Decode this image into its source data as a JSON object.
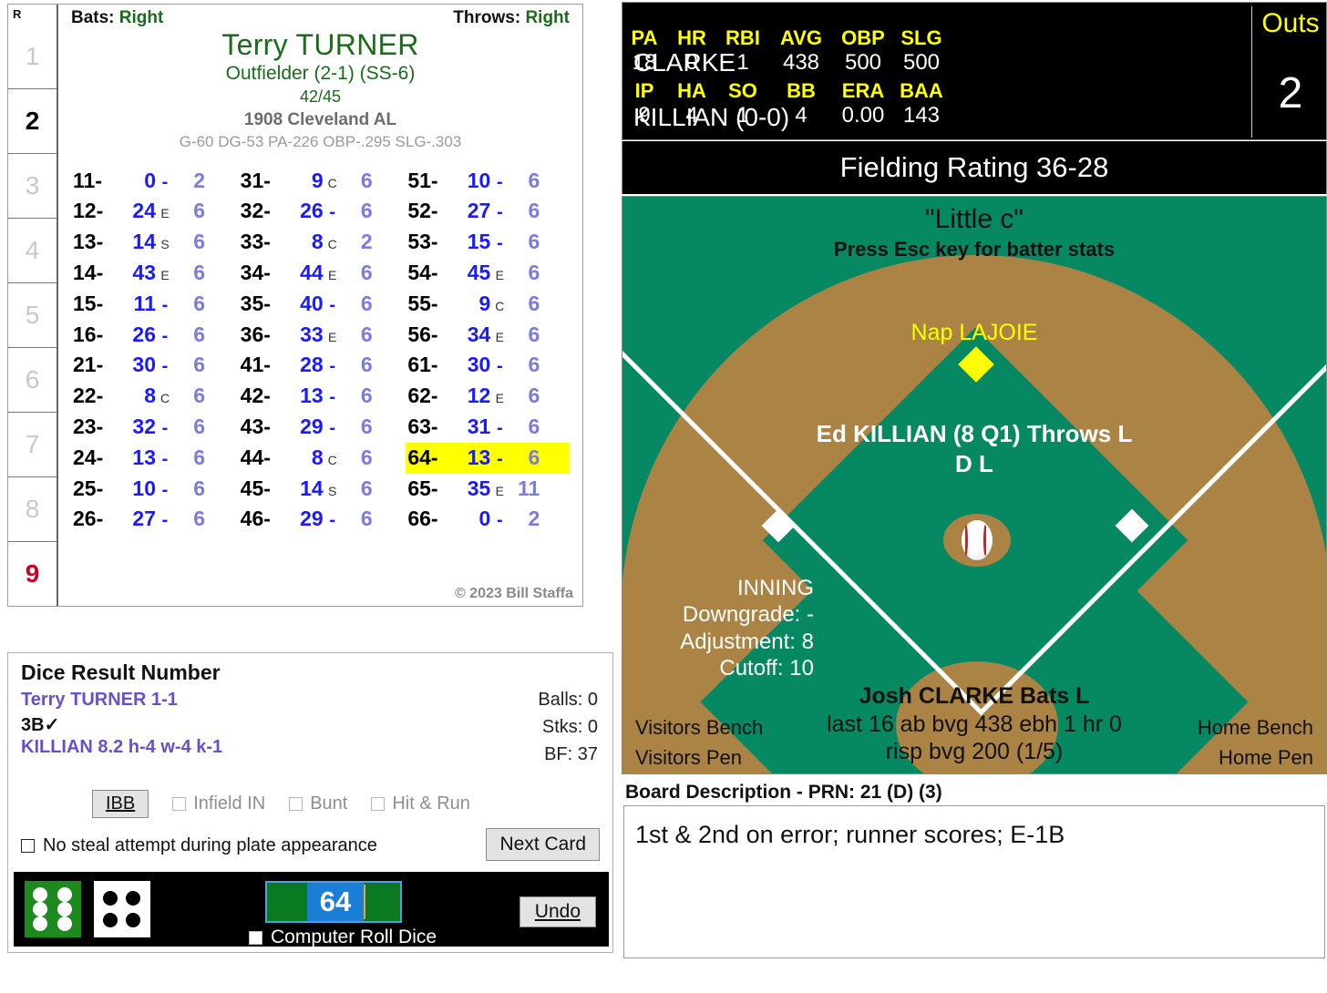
{
  "card": {
    "inning_header": "R",
    "innings": [
      "1",
      "2",
      "3",
      "4",
      "5",
      "6",
      "7",
      "8",
      "9"
    ],
    "active_inning": "2",
    "bats_label": "Bats:",
    "bats_value": "Right",
    "throws_label": "Throws:",
    "throws_value": "Right",
    "player_name": "Terry TURNER",
    "position": "Outfielder (2-1) (SS-6)",
    "card_number": "42/45",
    "team": "1908 Cleveland AL",
    "season_stats": "G-60 DG-53 PA-226 OBP-.295 SLG-.303",
    "copyright": "© 2023 Bill Staffa",
    "highlight_key": "64-",
    "columns": [
      [
        {
          "k": "11-",
          "r": "0",
          "f": "-",
          "n": "2"
        },
        {
          "k": "12-",
          "r": "24",
          "f": "E",
          "n": "6"
        },
        {
          "k": "13-",
          "r": "14",
          "f": "S",
          "n": "6"
        },
        {
          "k": "14-",
          "r": "43",
          "f": "E",
          "n": "6"
        },
        {
          "k": "15-",
          "r": "11",
          "f": "-",
          "n": "6"
        },
        {
          "k": "16-",
          "r": "26",
          "f": "-",
          "n": "6"
        },
        {
          "k": "21-",
          "r": "30",
          "f": "-",
          "n": "6"
        },
        {
          "k": "22-",
          "r": "8",
          "f": "C",
          "n": "6"
        },
        {
          "k": "23-",
          "r": "32",
          "f": "-",
          "n": "6"
        },
        {
          "k": "24-",
          "r": "13",
          "f": "-",
          "n": "6"
        },
        {
          "k": "25-",
          "r": "10",
          "f": "-",
          "n": "6"
        },
        {
          "k": "26-",
          "r": "27",
          "f": "-",
          "n": "6"
        }
      ],
      [
        {
          "k": "31-",
          "r": "9",
          "f": "C",
          "n": "6"
        },
        {
          "k": "32-",
          "r": "26",
          "f": "-",
          "n": "6"
        },
        {
          "k": "33-",
          "r": "8",
          "f": "C",
          "n": "2"
        },
        {
          "k": "34-",
          "r": "44",
          "f": "E",
          "n": "6"
        },
        {
          "k": "35-",
          "r": "40",
          "f": "-",
          "n": "6"
        },
        {
          "k": "36-",
          "r": "33",
          "f": "E",
          "n": "6"
        },
        {
          "k": "41-",
          "r": "28",
          "f": "-",
          "n": "6"
        },
        {
          "k": "42-",
          "r": "13",
          "f": "-",
          "n": "6"
        },
        {
          "k": "43-",
          "r": "29",
          "f": "-",
          "n": "6"
        },
        {
          "k": "44-",
          "r": "8",
          "f": "C",
          "n": "6"
        },
        {
          "k": "45-",
          "r": "14",
          "f": "S",
          "n": "6"
        },
        {
          "k": "46-",
          "r": "29",
          "f": "-",
          "n": "6"
        }
      ],
      [
        {
          "k": "51-",
          "r": "10",
          "f": "-",
          "n": "6"
        },
        {
          "k": "52-",
          "r": "27",
          "f": "-",
          "n": "6"
        },
        {
          "k": "53-",
          "r": "15",
          "f": "-",
          "n": "6"
        },
        {
          "k": "54-",
          "r": "45",
          "f": "E",
          "n": "6"
        },
        {
          "k": "55-",
          "r": "9",
          "f": "C",
          "n": "6"
        },
        {
          "k": "56-",
          "r": "34",
          "f": "E",
          "n": "6"
        },
        {
          "k": "61-",
          "r": "30",
          "f": "-",
          "n": "6"
        },
        {
          "k": "62-",
          "r": "12",
          "f": "E",
          "n": "6"
        },
        {
          "k": "63-",
          "r": "31",
          "f": "-",
          "n": "6"
        },
        {
          "k": "64-",
          "r": "13",
          "f": "-",
          "n": "6"
        },
        {
          "k": "65-",
          "r": "35",
          "f": "E",
          "n": "11"
        },
        {
          "k": "66-",
          "r": "0",
          "f": "-",
          "n": "2"
        }
      ]
    ]
  },
  "dice_panel": {
    "title": "Dice Result Number",
    "line1": "Terry TURNER  1-1",
    "line2": "3B✓",
    "line3": "KILLIAN  8.2  h-4  w-4  k-1",
    "balls": "Balls: 0",
    "strikes": "Stks: 0",
    "bf": "BF: 37",
    "ibb_button": "IBB",
    "infield_in": "Infield IN",
    "bunt": "Bunt",
    "hit_and_run": "Hit & Run",
    "no_steal": "No steal attempt during plate appearance",
    "next_card": "Next Card",
    "computer_roll": "Computer Roll Dice",
    "undo": "Undo",
    "roll_value": "64",
    "die1_value": "6",
    "die2_value": "4"
  },
  "scoreboard": {
    "batter_name": "CLARKE",
    "pitcher_name": "KILLIAN (0-0)",
    "batter_headers": [
      "PA",
      "HR",
      "RBI",
      "AVG",
      "OBP",
      "SLG"
    ],
    "batter_values": [
      "18",
      "0",
      "1",
      "438",
      "500",
      "500"
    ],
    "pitcher_headers": [
      "IP",
      "HA",
      "SO",
      "BB",
      "ERA",
      "BAA"
    ],
    "pitcher_values": [
      "9",
      "4",
      "1",
      "4",
      "0.00",
      "143"
    ],
    "outs_label": "Outs",
    "outs_value": "2",
    "fielding_rating": "Fielding Rating 36-28"
  },
  "field": {
    "little_c": "\"Little c\"",
    "esc_hint": "Press Esc key for batter stats",
    "shortstop_name": "Nap LAJOIE",
    "pitcher_line": "Ed KILLIAN (8 Q1) Throws L",
    "pitcher_hand": "D L",
    "inning_label": "INNING",
    "downgrade": "Downgrade: -",
    "adjustment": "Adjustment: 8",
    "cutoff": "Cutoff: 10",
    "batter_line": "Josh CLARKE Bats L",
    "batter_last": "last 16 ab bvg 438 ebh 1 hr 0",
    "batter_risp": "risp bvg 200 (1/5)",
    "visitors_bench": "Visitors Bench",
    "visitors_pen": "Visitors Pen",
    "home_bench": "Home Bench",
    "home_pen": "Home Pen"
  },
  "board": {
    "label": "Board Description - PRN: 21 (D) (3)",
    "text": "1st & 2nd on error; runner scores; E-1B"
  },
  "colors": {
    "grass": "#068863",
    "dirt": "#ab8445",
    "accent_yellow": "#ffff00",
    "card_green": "#1a6b1a",
    "result_blue": "#1a1aff",
    "count_purple": "#7b7be0",
    "highlight": "#ffff00",
    "die_green": "#1c8a1c"
  }
}
